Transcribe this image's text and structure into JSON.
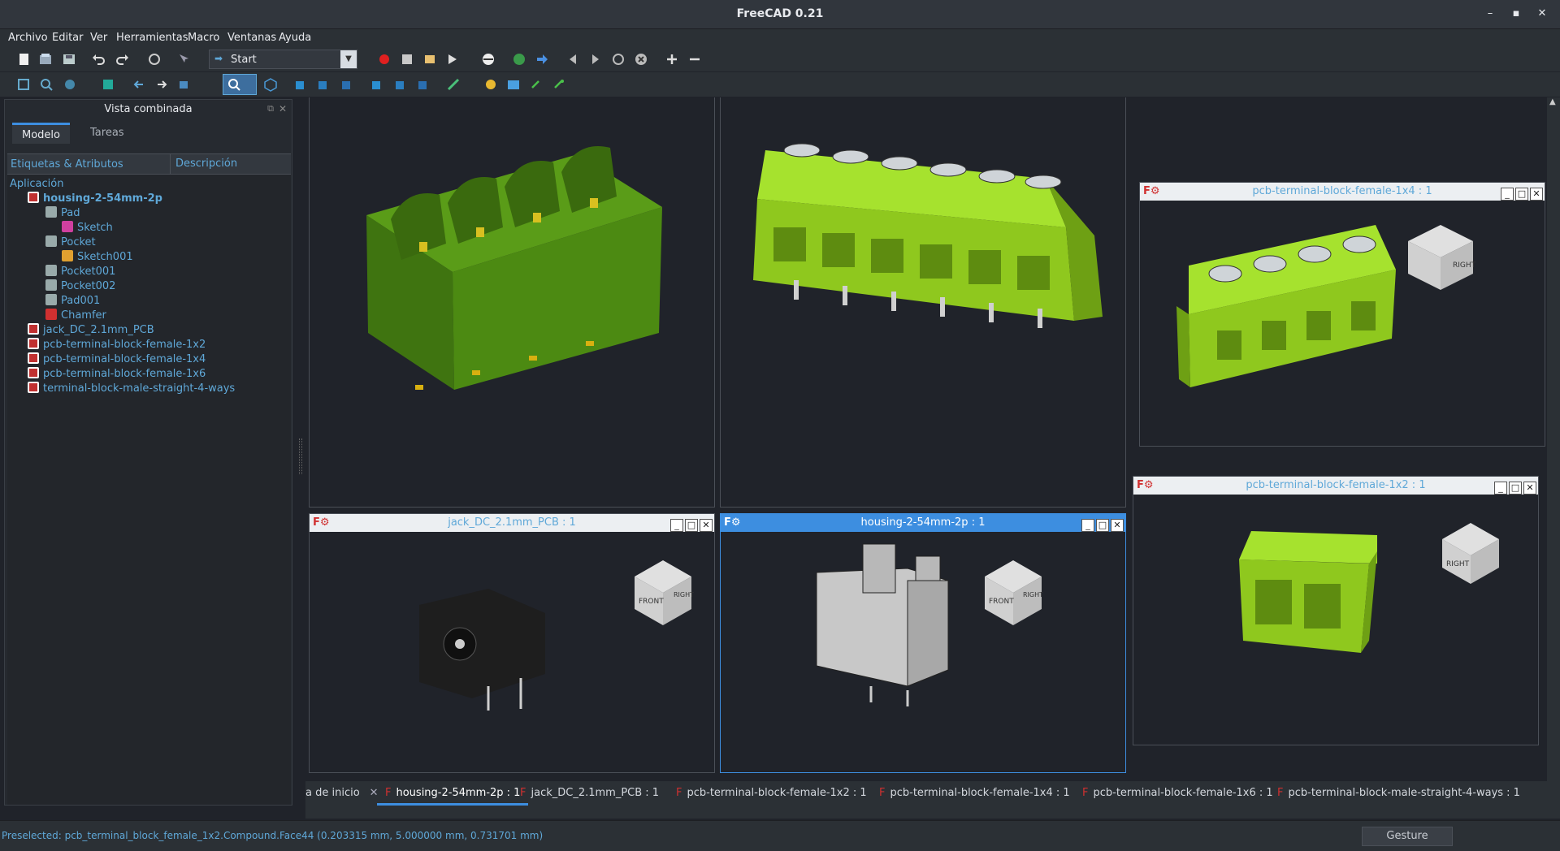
{
  "window": {
    "title": "FreeCAD 0.21"
  },
  "menu": [
    "Archivo",
    "Editar",
    "Ver",
    "Herramientas",
    "Macro",
    "Ventanas",
    "Ayuda"
  ],
  "toolbar": {
    "workbench": "Start"
  },
  "panel": {
    "title": "Vista combinada",
    "tabs": [
      "Modelo",
      "Tareas"
    ],
    "columns": [
      "Etiquetas & Atributos",
      "Descripción"
    ],
    "section": "Aplicación",
    "items": [
      {
        "label": "housing-2-54mm-2p",
        "indent": 0,
        "bold": true,
        "icon": "document-icon"
      },
      {
        "label": "Pad",
        "indent": 1,
        "icon": "pad-icon"
      },
      {
        "label": "Sketch",
        "indent": 2,
        "icon": "sketch-icon"
      },
      {
        "label": "Pocket",
        "indent": 1,
        "icon": "pocket-icon"
      },
      {
        "label": "Sketch001",
        "indent": 2,
        "icon": "sketch-icon"
      },
      {
        "label": "Pocket001",
        "indent": 1,
        "icon": "pocket-icon"
      },
      {
        "label": "Pocket002",
        "indent": 1,
        "icon": "pocket-icon"
      },
      {
        "label": "Pad001",
        "indent": 1,
        "icon": "pad-icon"
      },
      {
        "label": "Chamfer",
        "indent": 1,
        "icon": "chamfer-icon"
      },
      {
        "label": "jack_DC_2.1mm_PCB",
        "indent": 0,
        "icon": "document-icon"
      },
      {
        "label": "pcb-terminal-block-female-1x2",
        "indent": 0,
        "icon": "document-icon"
      },
      {
        "label": "pcb-terminal-block-female-1x4",
        "indent": 0,
        "icon": "document-icon"
      },
      {
        "label": "pcb-terminal-block-female-1x6",
        "indent": 0,
        "icon": "document-icon"
      },
      {
        "label": "terminal-block-male-straight-4-ways",
        "indent": 0,
        "icon": "document-icon"
      }
    ]
  },
  "subwindows": {
    "jack": "jack_DC_2.1mm_PCB : 1",
    "housing": "housing-2-54mm-2p : 1",
    "b1x4": "pcb-terminal-block-female-1x4 : 1",
    "b1x2": "pcb-terminal-block-female-1x2 : 1"
  },
  "cube_faces": {
    "front": "FRONT",
    "right": "RIGHT"
  },
  "doc_tabs": [
    "a de inicio",
    "housing-2-54mm-2p : 1",
    "jack_DC_2.1mm_PCB : 1",
    "pcb-terminal-block-female-1x2 : 1",
    "pcb-terminal-block-female-1x4 : 1",
    "pcb-terminal-block-female-1x6 : 1",
    "pcb-terminal-block-male-straight-4-ways : 1"
  ],
  "status": {
    "message": "Preselected: pcb_terminal_block_female_1x2.Compound.Face44 (0.203315 mm, 5.000000 mm, 0.731701 mm)",
    "nav_style": "Gesture"
  },
  "colors": {
    "green_bright": "#a6e22e",
    "green_dark": "#4c8a12",
    "accent": "#3d8ee0",
    "link": "#5fa8d8"
  }
}
